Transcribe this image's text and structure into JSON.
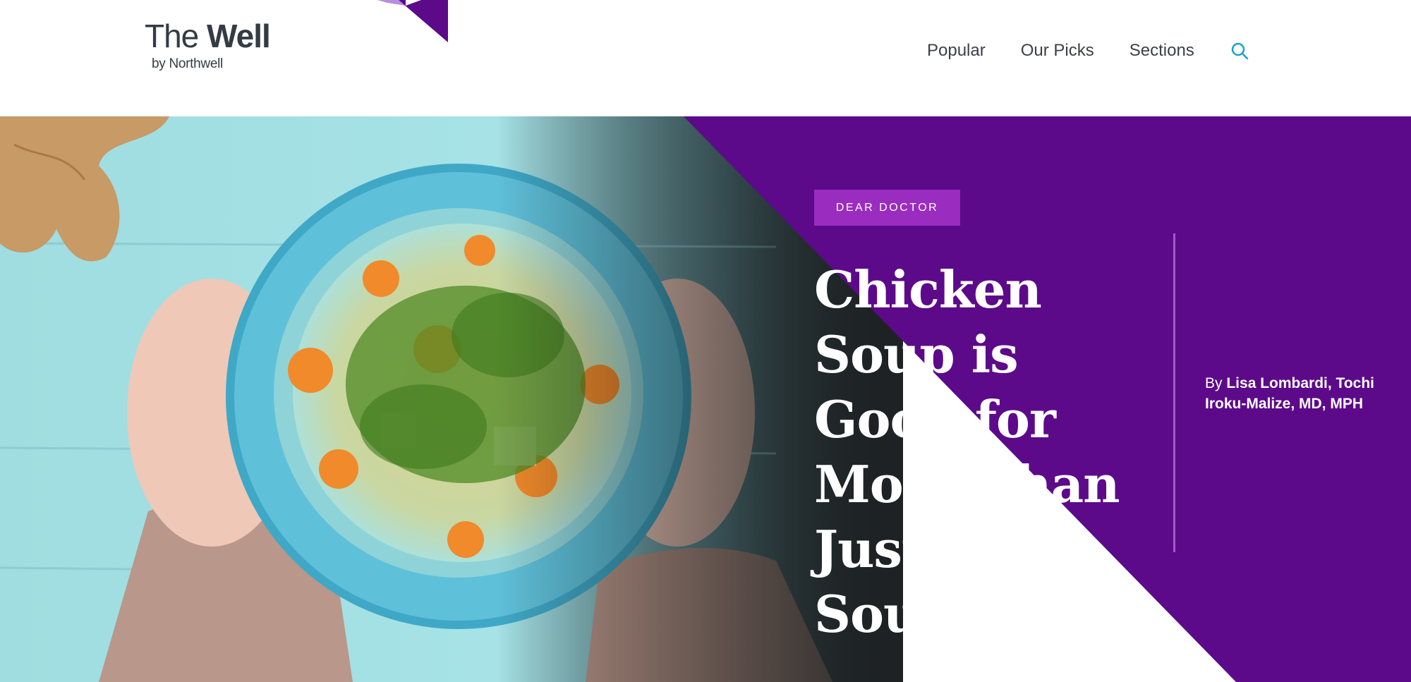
{
  "brand": {
    "name_light": "The ",
    "name_bold": "Well",
    "sub": "by Northwell",
    "accent_color": "#5c0a8a",
    "mark_color": "#7b36c7"
  },
  "nav": {
    "items": [
      {
        "label": "Popular"
      },
      {
        "label": "Our Picks"
      },
      {
        "label": "Sections"
      }
    ],
    "search_icon": "search-icon",
    "search_color": "#1aa1d6"
  },
  "article": {
    "category": "DEAR DOCTOR",
    "title": "Chicken Soup is Good for More Than Just the Soul",
    "byline_prefix": "By",
    "authors": "Lisa Lombardi, Tochi Iroku-Malize, MD, MPH",
    "badge_color": "#9b2cc0",
    "panel_color": "#5c0a8a"
  },
  "hero_image": {
    "subject": "soup-bowl-photo"
  }
}
